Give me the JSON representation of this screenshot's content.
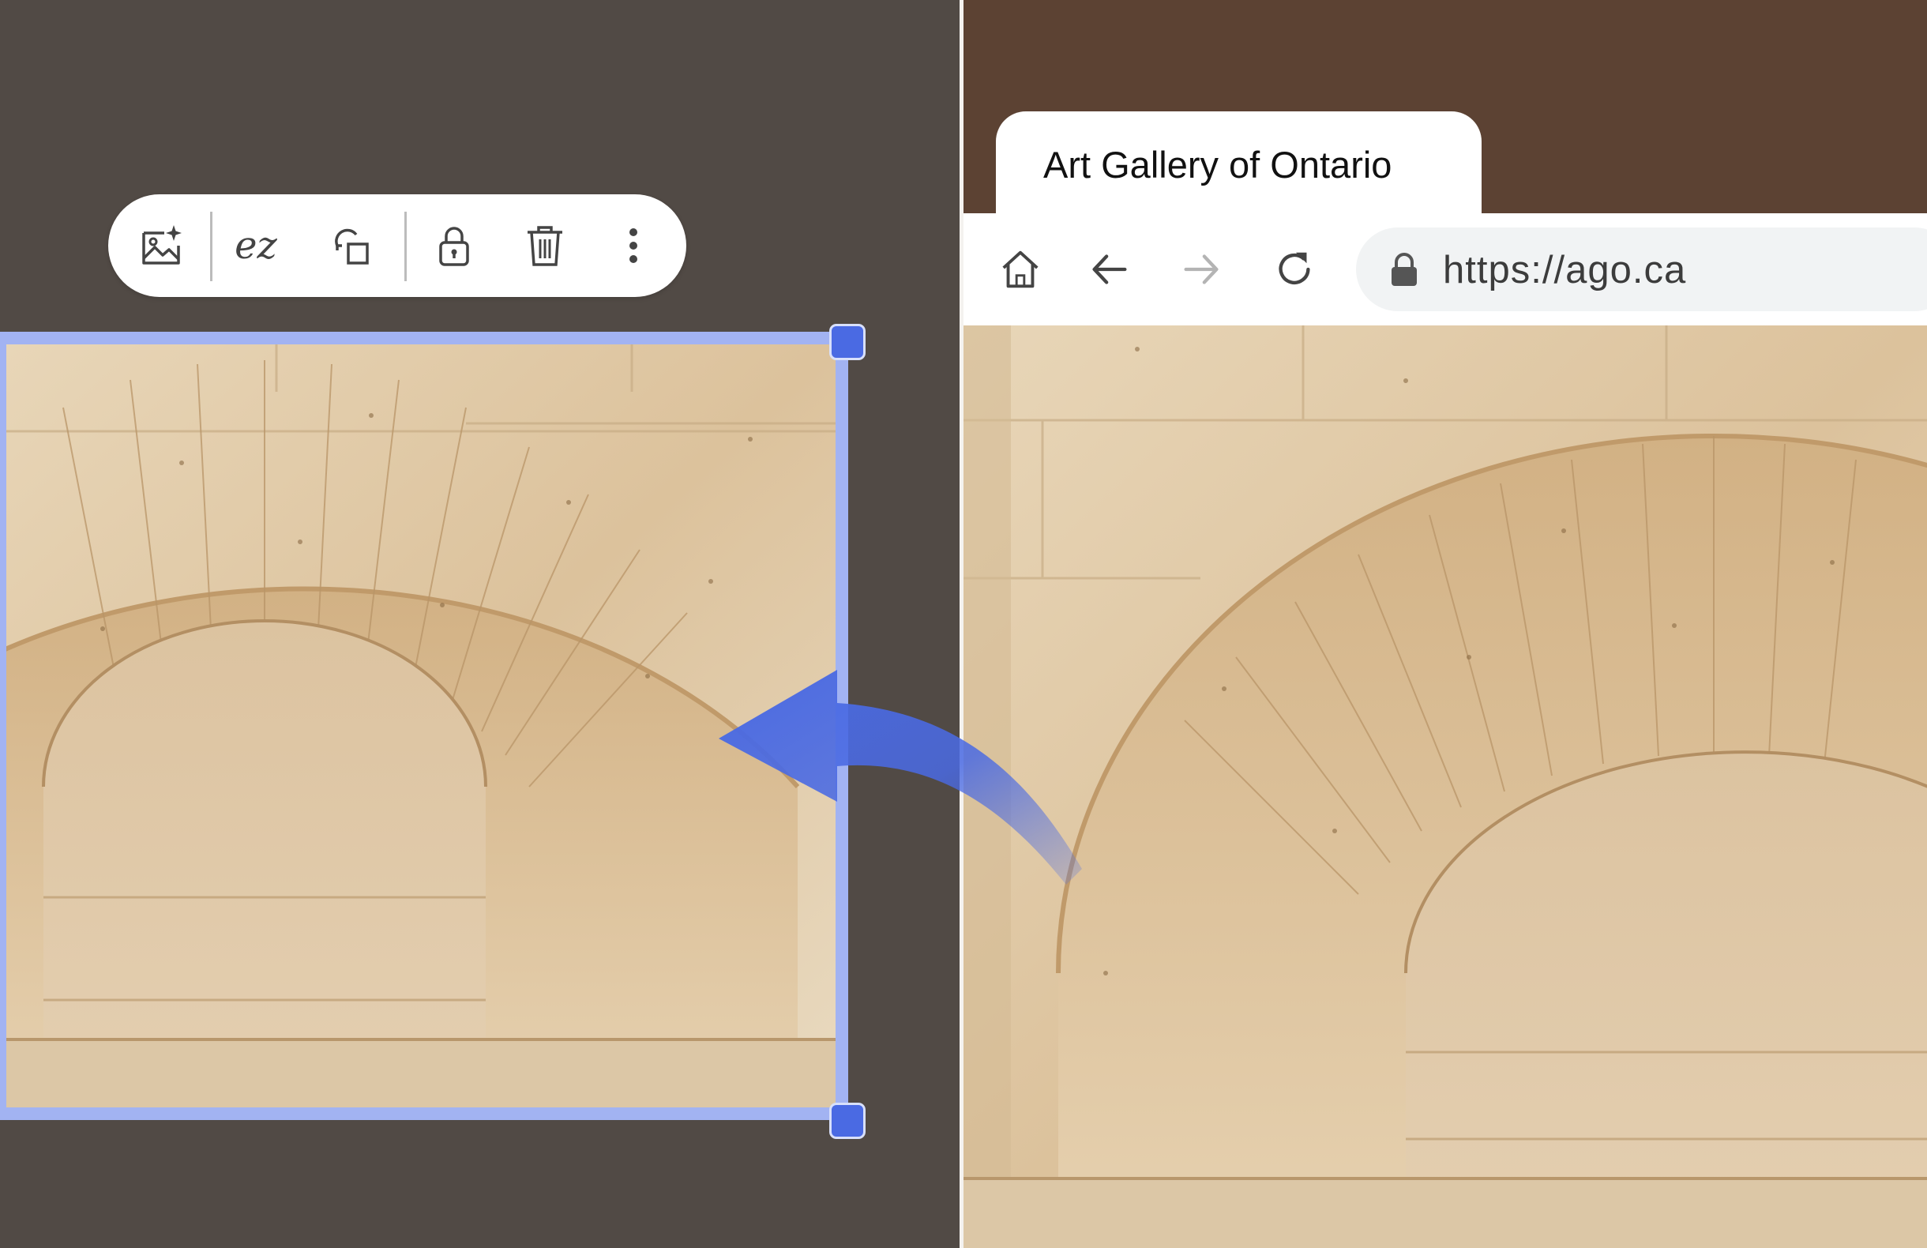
{
  "toolbar": {
    "items": [
      {
        "icon": "ai-image-icon"
      },
      {
        "icon": "signature-icon",
        "label": "ez"
      },
      {
        "icon": "duplicate-icon"
      },
      {
        "icon": "lock-icon"
      },
      {
        "icon": "trash-icon"
      },
      {
        "icon": "more-vertical-icon"
      }
    ]
  },
  "browser": {
    "tab_title": "Art Gallery of Ontario",
    "url": "https://ago.ca",
    "nav": [
      "home-icon",
      "back-icon",
      "forward-icon",
      "reload-icon"
    ]
  },
  "colors": {
    "editor_bg": "#514a45",
    "browser_chrome": "#5c4233",
    "selection": "#a2b3f2",
    "accent": "#4a6ae3",
    "stone": "#e3cfb0"
  }
}
